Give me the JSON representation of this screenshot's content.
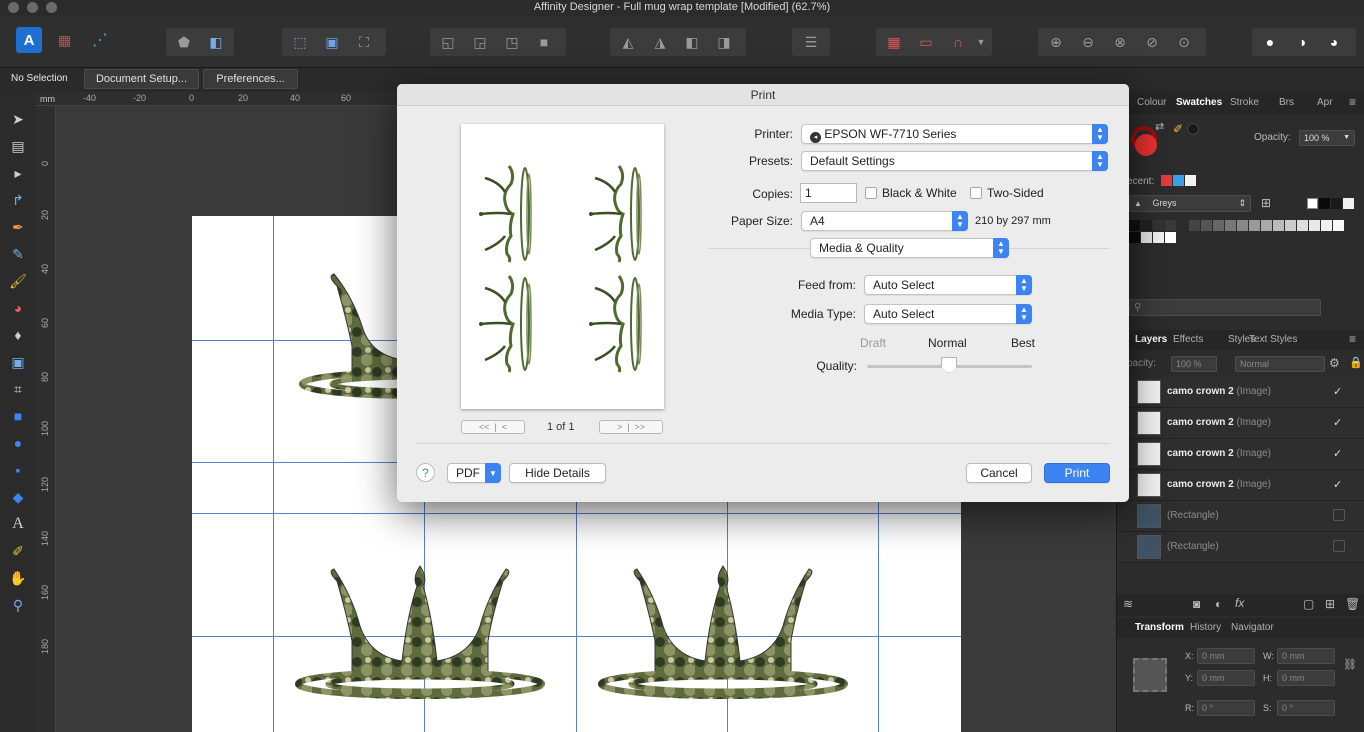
{
  "window": {
    "title": "Affinity Designer - Full mug wrap template [Modified] (62.7%)"
  },
  "context_bar": {
    "selection": "No Selection",
    "document_setup": "Document Setup...",
    "preferences": "Preferences..."
  },
  "rulers": {
    "top": [
      "-40",
      "-20",
      "0",
      "20",
      "40",
      "60"
    ],
    "left": [
      "0",
      "20",
      "40",
      "60",
      "80",
      "100",
      "120",
      "140",
      "160",
      "180"
    ],
    "unit": "mm"
  },
  "right_panel": {
    "top_tabs": [
      "Colour",
      "Swatches",
      "Stroke",
      "Brs",
      "Apr"
    ],
    "active_top_tab": "Swatches",
    "opacity_label": "Opacity:",
    "opacity_value": "100 %",
    "recent_label": "ecent:",
    "palette_name": "Greys",
    "layer_tabs": [
      "Layers",
      "Effects",
      "Styles",
      "Text Styles"
    ],
    "active_layer_tab": "Layers",
    "layer_opacity_label": "pacity:",
    "layer_opacity_value": "100 %",
    "blend_mode": "Normal",
    "layers": [
      {
        "name": "camo crown 2",
        "type": "(Image)",
        "checked": "✓"
      },
      {
        "name": "camo crown 2",
        "type": "(Image)",
        "checked": "✓"
      },
      {
        "name": "camo crown 2",
        "type": "(Image)",
        "checked": "✓"
      },
      {
        "name": "camo crown 2",
        "type": "(Image)",
        "checked": "✓"
      },
      {
        "name": "",
        "type": "(Rectangle)",
        "checked": ""
      },
      {
        "name": "",
        "type": "(Rectangle)",
        "checked": ""
      }
    ],
    "transform_tabs": [
      "Transform",
      "History",
      "Navigator"
    ],
    "active_transform_tab": "Transform",
    "transform": {
      "x_label": "X:",
      "x": "0 mm",
      "w_label": "W:",
      "w": "0 mm",
      "y_label": "Y:",
      "y": "0 mm",
      "h_label": "H:",
      "h": "0 mm",
      "r_label": "R:",
      "r": "0 °",
      "s_label": "S:",
      "s": "0 °"
    }
  },
  "print_dialog": {
    "title": "Print",
    "page_indicator": "1 of 1",
    "printer_label": "Printer:",
    "printer_value": "EPSON WF-7710 Series",
    "presets_label": "Presets:",
    "presets_value": "Default Settings",
    "copies_label": "Copies:",
    "copies_value": "1",
    "black_white_label": "Black & White",
    "two_sided_label": "Two-Sided",
    "paper_size_label": "Paper Size:",
    "paper_size_value": "A4",
    "paper_dims": "210 by 297 mm",
    "section_value": "Media & Quality",
    "feed_from_label": "Feed from:",
    "feed_from_value": "Auto Select",
    "media_type_label": "Media Type:",
    "media_type_value": "Auto Select",
    "quality_label": "Quality:",
    "quality_levels": [
      "Draft",
      "Normal",
      "Best"
    ],
    "quality_selected": "Normal",
    "help_label": "?",
    "pdf_label": "PDF",
    "hide_details_label": "Hide Details",
    "cancel_label": "Cancel",
    "print_label": "Print"
  },
  "colors": {
    "accent": "#3b84f2",
    "guide": "#5a7ec8",
    "recent_swatches": [
      "#e23c3c",
      "#3aa0e8",
      "#f4f4f4"
    ]
  }
}
